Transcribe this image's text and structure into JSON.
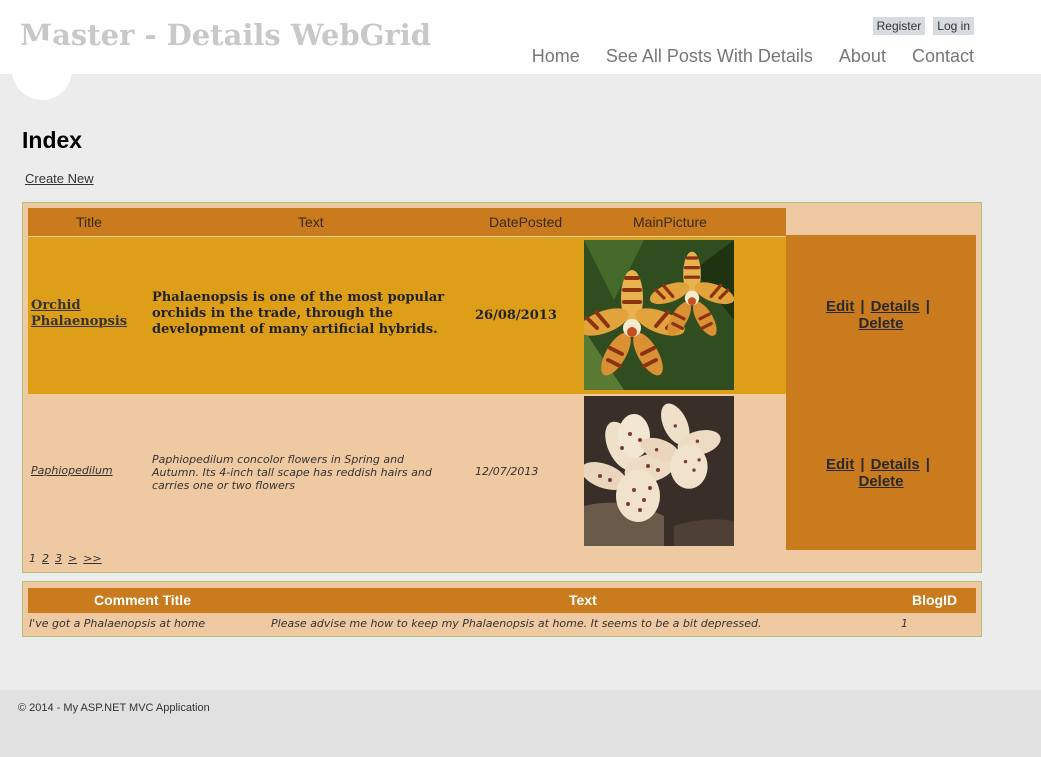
{
  "header": {
    "site_title": "Master - Details WebGrid",
    "register_label": "Register",
    "login_label": "Log in",
    "nav": [
      "Home",
      "See All Posts With Details",
      "About",
      "Contact"
    ]
  },
  "main": {
    "page_title": "Index",
    "create_new_label": "Create New"
  },
  "grid": {
    "columns": [
      "Title",
      "Text",
      "DatePosted",
      "MainPicture"
    ],
    "rows": [
      {
        "title_line1": "Orchid",
        "title_line2": "Phalaenopsis",
        "text": "Phalaenopsis is one of the most popular orchids in the trade, through the development of many artificial hybrids.",
        "date": "26/08/2013",
        "picture": "phalaenopsis-orchid-photo"
      },
      {
        "title": "Paphiopedilum",
        "text": "Paphiopedilum concolor flowers in Spring and Autumn. Its 4-inch tall scape has reddish hairs and carries one or two flowers",
        "date": "12/07/2013",
        "picture": "paphiopedilum-orchid-photo"
      }
    ],
    "actions": {
      "edit": "Edit",
      "details": "Details",
      "delete": "Delete",
      "separator": "|"
    },
    "pager": [
      "1",
      "2",
      "3",
      ">",
      ">>"
    ]
  },
  "comments": {
    "columns": [
      "Comment Title",
      "Text",
      "BlogID"
    ],
    "rows": [
      {
        "title": "I've got a Phalaenopsis at home",
        "text": "Please advise me how to keep my Phalaenopsis at home. It seems to be a bit depressed.",
        "blog_id": "1"
      }
    ]
  },
  "footer": {
    "copyright": "© 2014 - My ASP.NET MVC Application"
  },
  "colors": {
    "header_bg": "#ffffff",
    "page_bg": "#ececec",
    "grid_header": "#c97b1e",
    "selected_row": "#dd9f17",
    "alt_row": "#efc9a2"
  }
}
